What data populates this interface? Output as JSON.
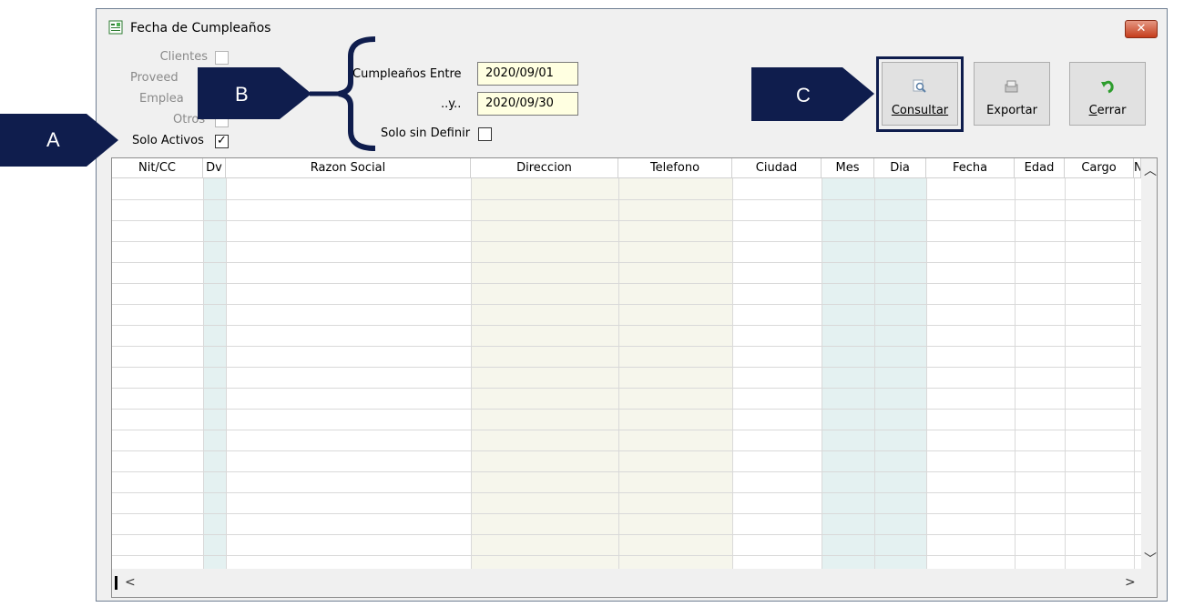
{
  "window": {
    "title": "Fecha de Cumpleaños",
    "close_glyph": "✕"
  },
  "filters": {
    "clientes": "Clientes",
    "proveedores": "Proveed",
    "empleados": "Emplea",
    "otros": "Otros",
    "solo_activos": "Solo Activos",
    "solo_activos_checked": "✓",
    "cumple_entre": "Cumpleaños Entre",
    "y": "..y..",
    "date_from": "2020/09/01",
    "date_to": "2020/09/30",
    "solo_sin_definir": "Solo sin Definir"
  },
  "toolbar": {
    "consultar": "Consultar",
    "exportar": "Exportar",
    "cerrar": "Cerrar"
  },
  "grid": {
    "columns": [
      "Nit/CC",
      "Dv",
      "Razon Social",
      "Direccion",
      "Telefono",
      "Ciudad",
      "Mes",
      "Dia",
      "Fecha",
      "Edad",
      "Cargo",
      "N"
    ]
  },
  "callouts": {
    "a": "A",
    "b": "B",
    "c": "C"
  },
  "colors": {
    "callout": "#0f1d4d",
    "date_bg": "#ffffe1",
    "col_beige": "#f6f6ec",
    "col_teal": "#e4f1f1"
  }
}
